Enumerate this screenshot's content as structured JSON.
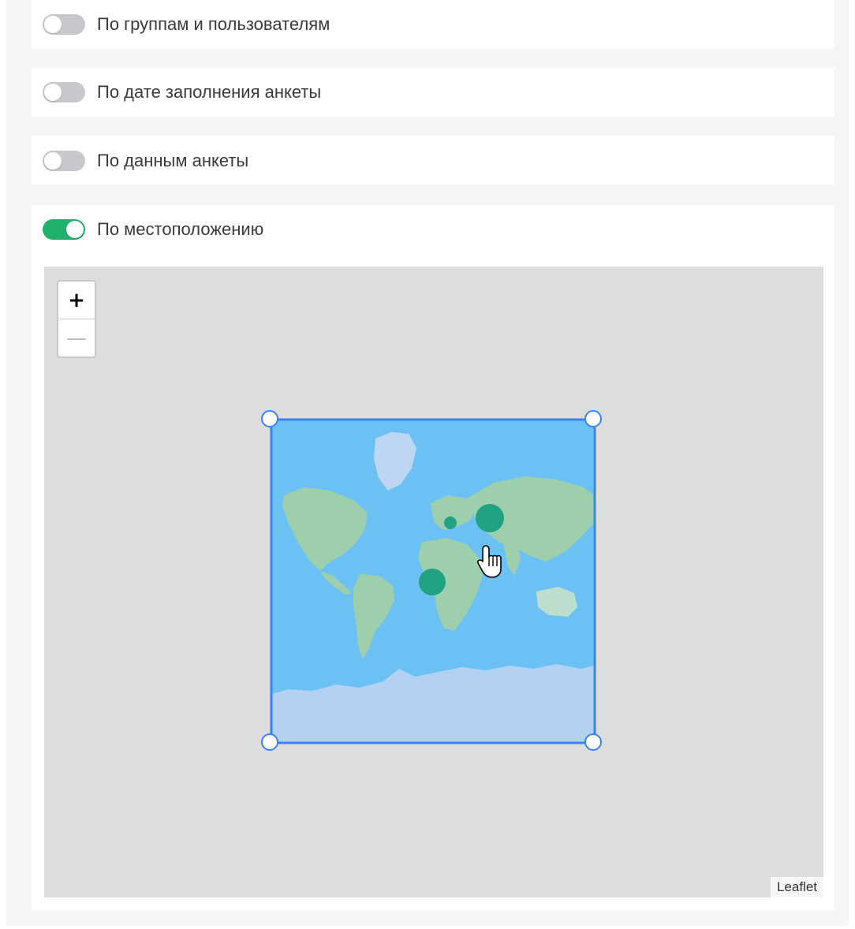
{
  "filters": [
    {
      "label": "По группам и пользователям",
      "enabled": false
    },
    {
      "label": "По дате заполнения анкеты",
      "enabled": false
    },
    {
      "label": "По данным анкеты",
      "enabled": false
    },
    {
      "label": "По местоположению",
      "enabled": true
    }
  ],
  "map": {
    "zoom_in_label": "+",
    "zoom_out_label": "—",
    "attribution": "Leaflet"
  },
  "colors": {
    "toggle_on": "#22b06d",
    "toggle_off": "#c8c8cc",
    "selection": "#3b82f6",
    "ocean": "#6fc7f5",
    "land": "#a6d6a8",
    "ice": "#bcd8f3",
    "markers": "#1fa67a"
  }
}
